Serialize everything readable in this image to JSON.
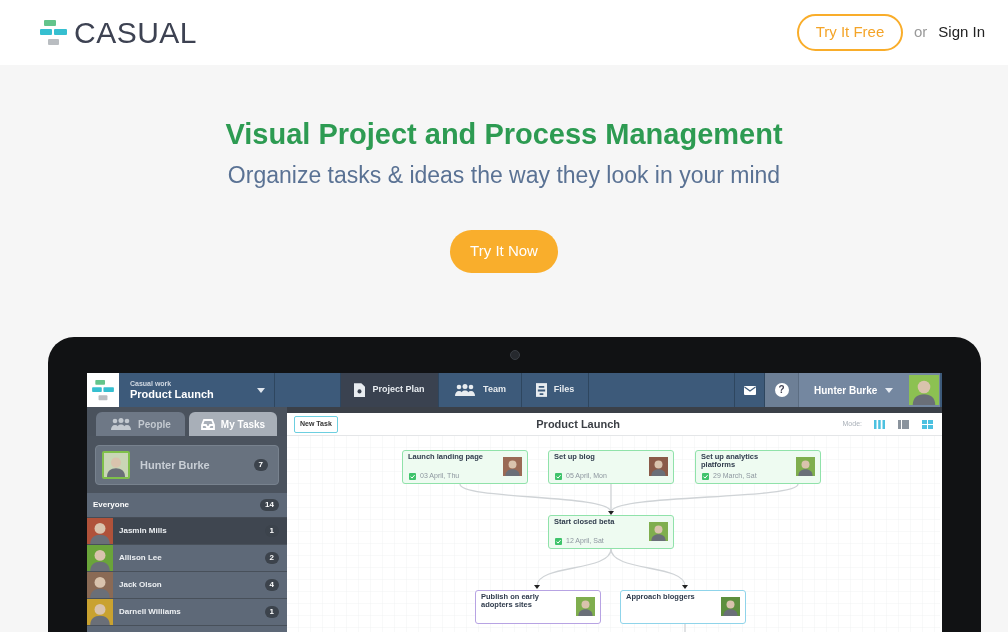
{
  "header": {
    "logo": "CASUAL",
    "try_free": "Try It Free",
    "or": "or",
    "sign_in": "Sign In"
  },
  "hero": {
    "title": "Visual Project and Process Management",
    "subtitle": "Organize tasks & ideas the way they look in your mind",
    "cta": "Try It Now"
  },
  "app": {
    "workspace_label": "Casual work",
    "project": "Product Launch",
    "nav": [
      {
        "label": "Project Plan",
        "kind": "document",
        "selected": true
      },
      {
        "label": "Team",
        "kind": "people",
        "selected": false
      },
      {
        "label": "Files",
        "kind": "files",
        "selected": false
      }
    ],
    "help": "?",
    "user": "Hunter Burke",
    "side_tabs": [
      {
        "label": "People",
        "kind": "people",
        "selected": false
      },
      {
        "label": "My Tasks",
        "kind": "tray",
        "selected": true
      }
    ],
    "me": {
      "name": "Hunter Burke",
      "count": "7"
    },
    "everyone": {
      "label": "Everyone",
      "count": "14"
    },
    "people": [
      {
        "name": "Jasmin Mills",
        "count": "1",
        "selected": true
      },
      {
        "name": "Allison Lee",
        "count": "2",
        "selected": false
      },
      {
        "name": "Jack Olson",
        "count": "4",
        "selected": false
      },
      {
        "name": "Darnell Williams",
        "count": "1",
        "selected": false
      }
    ],
    "canvas": {
      "new_task": "New Task",
      "title": "Product Launch",
      "mode_label": "Mode:"
    },
    "tasks": [
      {
        "title": "Launch landing page",
        "date": "03 April, Thu",
        "done": true,
        "color": "#90e2aa"
      },
      {
        "title": "Set up blog",
        "date": "05 April, Mon",
        "done": true,
        "color": "#90e2aa"
      },
      {
        "title": "Set up analytics platforms",
        "date": "29 March, Sat",
        "done": true,
        "color": "#90e2aa"
      },
      {
        "title": "Start closed beta",
        "date": "12 April, Sat",
        "done": true,
        "color": "#90e2aa"
      },
      {
        "title": "Publish on early adopters sites",
        "color": "#b7a3e3"
      },
      {
        "title": "Approach bloggers",
        "color": "#8fd4ea"
      }
    ]
  }
}
